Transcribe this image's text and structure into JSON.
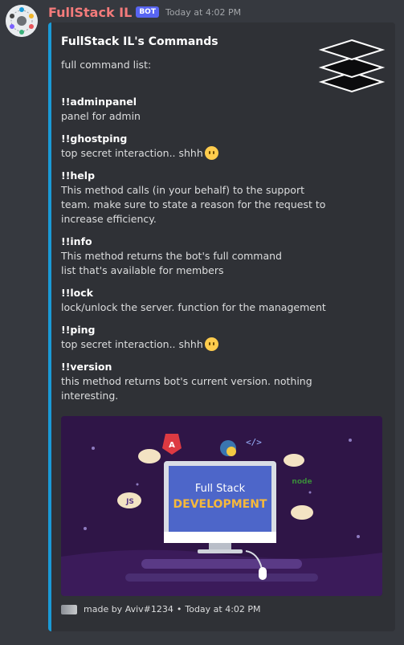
{
  "message": {
    "author": "FullStack IL",
    "badge": "BOT",
    "timestamp": "Today at 4:02 PM"
  },
  "embed": {
    "title": "FullStack IL's Commands",
    "description": "full command list:",
    "accent_color": "#1a9ad6",
    "fields": [
      {
        "name": "!!adminpanel",
        "value": "panel for admin"
      },
      {
        "name": "!!ghostping",
        "value": "top secret interaction.. shhh",
        "emoji": "no-mouth-face"
      },
      {
        "name": "!!help",
        "value": "This method calls (in your behalf) to the support team. make sure to state a reason for the request to increase efficiency."
      },
      {
        "name": "!!info",
        "value": "This method returns the bot's full command list that's available for members"
      },
      {
        "name": "!!lock",
        "value": "lock/unlock the server. function for the management"
      },
      {
        "name": "!!ping",
        "value": "top secret interaction.. shhh",
        "emoji": "no-mouth-face"
      },
      {
        "name": "!!version",
        "value": "this method returns bot's current version. nothing interesting."
      }
    ],
    "image": {
      "line1": "Full Stack",
      "line2": "DEVELOPMENT",
      "badges": [
        "JS",
        "node",
        "</>"
      ]
    },
    "footer": {
      "text": "made by Aviv#1234",
      "separator": "•",
      "timestamp": "Today at 4:02 PM"
    }
  }
}
